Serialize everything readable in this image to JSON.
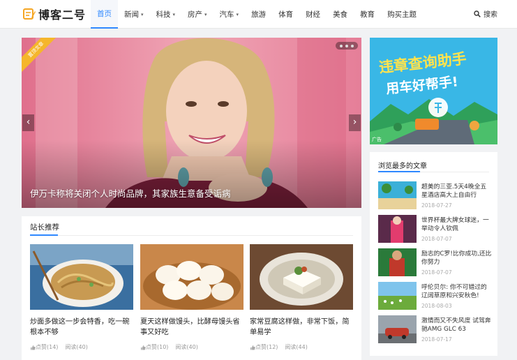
{
  "header": {
    "logo_text": "博客二号",
    "search_label": "搜索",
    "nav": [
      {
        "label": "首页",
        "active": true,
        "caret": false
      },
      {
        "label": "新闻",
        "active": false,
        "caret": true
      },
      {
        "label": "科技",
        "active": false,
        "caret": true
      },
      {
        "label": "房产",
        "active": false,
        "caret": true
      },
      {
        "label": "汽车",
        "active": false,
        "caret": true
      },
      {
        "label": "旅游",
        "active": false,
        "caret": false
      },
      {
        "label": "体育",
        "active": false,
        "caret": false
      },
      {
        "label": "财经",
        "active": false,
        "caret": false
      },
      {
        "label": "美食",
        "active": false,
        "caret": false
      },
      {
        "label": "教育",
        "active": false,
        "caret": false
      },
      {
        "label": "购买主题",
        "active": false,
        "caret": false
      }
    ]
  },
  "slider": {
    "ribbon": "置顶文章",
    "caption": "伊万卡称将关闭个人时尚品牌，其家族生意备受诟病",
    "prev": "‹",
    "next": "›",
    "dots": 3
  },
  "recommend": {
    "title": "站长推荐",
    "cards": [
      {
        "title": "炒面多做这一步会特香，吃一碗根本不够",
        "likes": "点赞(14)",
        "reads": "阅读(40)"
      },
      {
        "title": "夏天这样做馒头，比酵母馒头省事又好吃",
        "likes": "点赞(10)",
        "reads": "阅读(40)"
      },
      {
        "title": "家常豆腐这样做，非常下饭，简单易学",
        "likes": "点赞(12)",
        "reads": "阅读(44)"
      }
    ]
  },
  "ad": {
    "line1": "违章查询助手",
    "line2": "用车好帮手!",
    "tag": "广告"
  },
  "popular": {
    "title": "浏览最多的文章",
    "items": [
      {
        "title": "超美的三亚.5天4晚全五星酒店高大上自由行",
        "date": "2018-07-27"
      },
      {
        "title": "世界杯最大牌女球迷，一举动令人钦佩",
        "date": "2018-07-07"
      },
      {
        "title": "励志的C罗!比你成功,还比你努力",
        "date": "2018-07-07"
      },
      {
        "title": "呼伦贝尔: 你不可错过的辽阔草原和兴安秋色!",
        "date": "2018-08-03"
      },
      {
        "title": "激情而又不失风度 试驾奔驰AMG GLC 63",
        "date": "2018-07-17"
      }
    ]
  },
  "colors": {
    "accent": "#2f88ff",
    "ribbon": "#f5b62b"
  }
}
